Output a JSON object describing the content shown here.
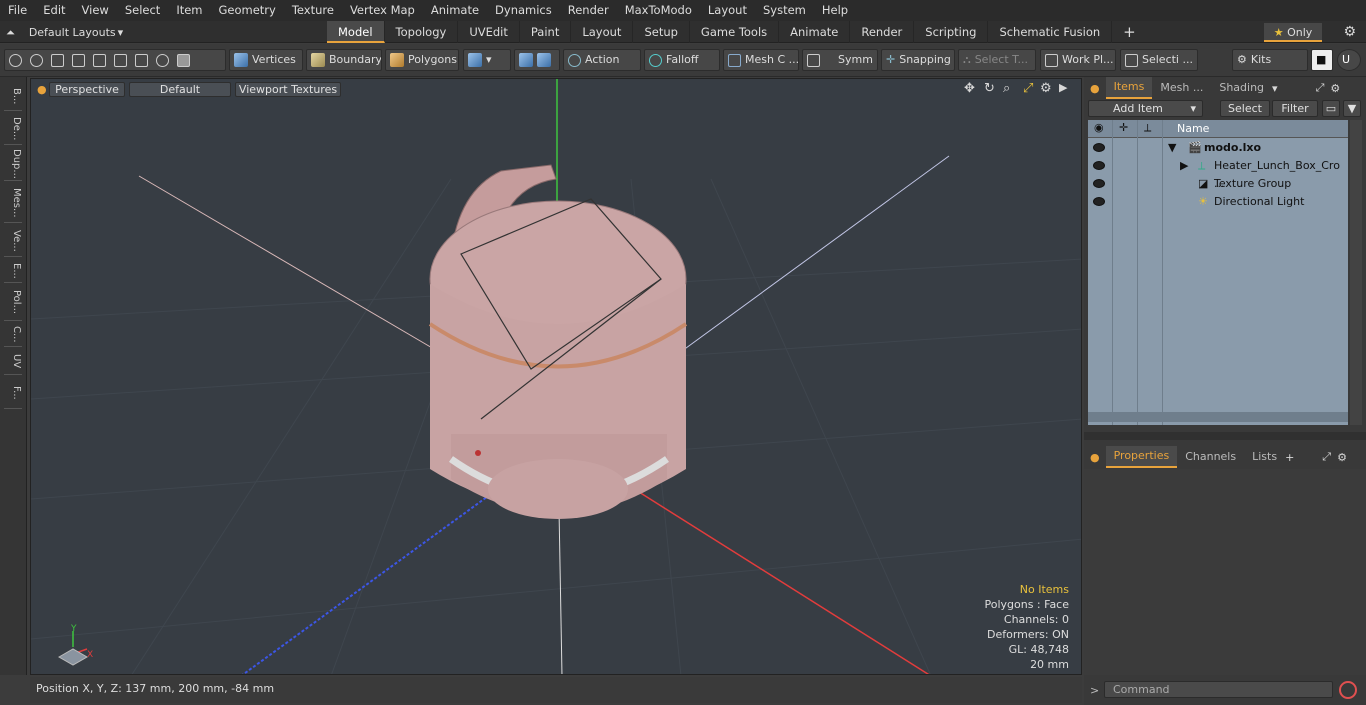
{
  "menu": [
    "File",
    "Edit",
    "View",
    "Select",
    "Item",
    "Geometry",
    "Texture",
    "Vertex Map",
    "Animate",
    "Dynamics",
    "Render",
    "MaxToModo",
    "Layout",
    "System",
    "Help"
  ],
  "layouts_label": "Default Layouts",
  "tabs": [
    "Model",
    "Topology",
    "UVEdit",
    "Paint",
    "Layout",
    "Setup",
    "Game Tools",
    "Animate",
    "Render",
    "Scripting",
    "Schematic Fusion"
  ],
  "only_label": "Only",
  "toolbar": {
    "vertices": "Vertices",
    "boundary": "Boundary",
    "polygons": "Polygons",
    "action": "Action",
    "falloff": "Falloff",
    "meshc": "Mesh C ...",
    "symm": "Symm ...",
    "snapping": "Snapping",
    "selectt": "Select T...",
    "workpl": "Work Pl...",
    "selecti": "Selecti ...",
    "kits": "Kits"
  },
  "left_tabs": [
    "B...",
    "De...",
    "Dup...",
    "Mes...",
    "Ve...",
    "E...",
    "Pol...",
    "C...",
    "UV",
    "F..."
  ],
  "viewport": {
    "perspective": "Perspective",
    "default": "Default",
    "textures": "Viewport Textures",
    "info": [
      "No Items",
      "Polygons : Face",
      "Channels: 0",
      "Deformers: ON",
      "GL: 48,748",
      "20 mm"
    ]
  },
  "status": "Position X, Y, Z:   137 mm, 200 mm, -84 mm",
  "panel": {
    "tabs": [
      "Items",
      "Mesh ...",
      "Shading"
    ],
    "add_item": "Add Item",
    "select": "Select",
    "filter": "Filter",
    "name_col": "Name",
    "items": [
      "modo.lxo",
      "Heater_Lunch_Box_Cro ...",
      "Texture Group",
      "Directional Light"
    ],
    "prop_tabs": [
      "Properties",
      "Channels",
      "Lists"
    ]
  },
  "command_placeholder": "Command"
}
